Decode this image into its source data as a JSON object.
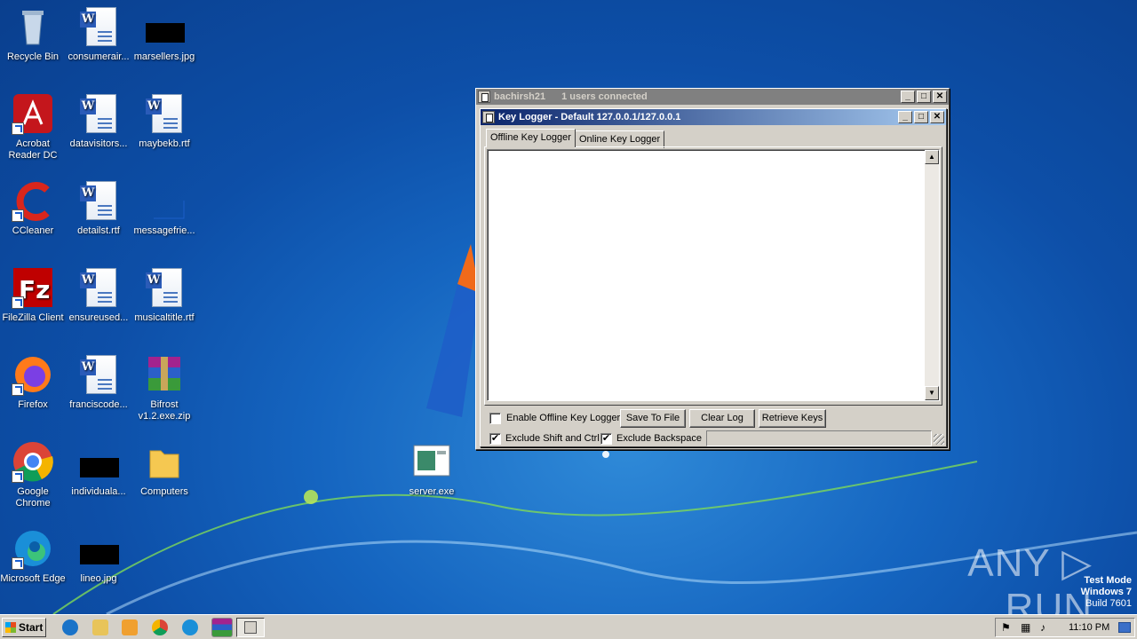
{
  "desktop": {
    "icons": [
      {
        "label": "Recycle Bin"
      },
      {
        "label": "consumerair..."
      },
      {
        "label": "marsellers.jpg"
      },
      {
        "label": "Acrobat Reader DC"
      },
      {
        "label": "datavisitors..."
      },
      {
        "label": "maybekb.rtf"
      },
      {
        "label": "CCleaner"
      },
      {
        "label": "detailst.rtf"
      },
      {
        "label": "messagefrie..."
      },
      {
        "label": "FileZilla Client"
      },
      {
        "label": "ensureused..."
      },
      {
        "label": "musicaltitle.rtf"
      },
      {
        "label": "Firefox"
      },
      {
        "label": "franciscode..."
      },
      {
        "label": "Bifrost v1.2.exe.zip"
      },
      {
        "label": "Google Chrome"
      },
      {
        "label": "individuala..."
      },
      {
        "label": "Computers"
      },
      {
        "label": "server.exe"
      },
      {
        "label": "Microsoft Edge"
      },
      {
        "label": "lineo.jpg"
      }
    ]
  },
  "outer_window": {
    "title": "bachirsh21",
    "users": "1 users connected"
  },
  "keylogger": {
    "title": "Key Logger - Default 127.0.0.1/127.0.0.1",
    "tabs": [
      "Offline Key Logger",
      "Online Key Logger"
    ],
    "enable_offline_label": "Enable Offline Key Logger",
    "save_label": "Save To File",
    "clear_label": "Clear Log",
    "retrieve_label": "Retrieve Keys",
    "exclude_shift_label": "Exclude Shift and Ctrl",
    "exclude_backspace_label": "Exclude Backspace",
    "exclude_shift_checked": "✔",
    "exclude_backspace_checked": "✔"
  },
  "window_controls": {
    "minimize": "_",
    "maximize": "□",
    "close": "✕"
  },
  "taskbar": {
    "start_label": "Start",
    "clock": "11:10 PM"
  },
  "watermark": {
    "brand": "ANY ▷ RUN",
    "mode": "Test Mode",
    "os": "Windows 7",
    "build": "Build 7601"
  }
}
